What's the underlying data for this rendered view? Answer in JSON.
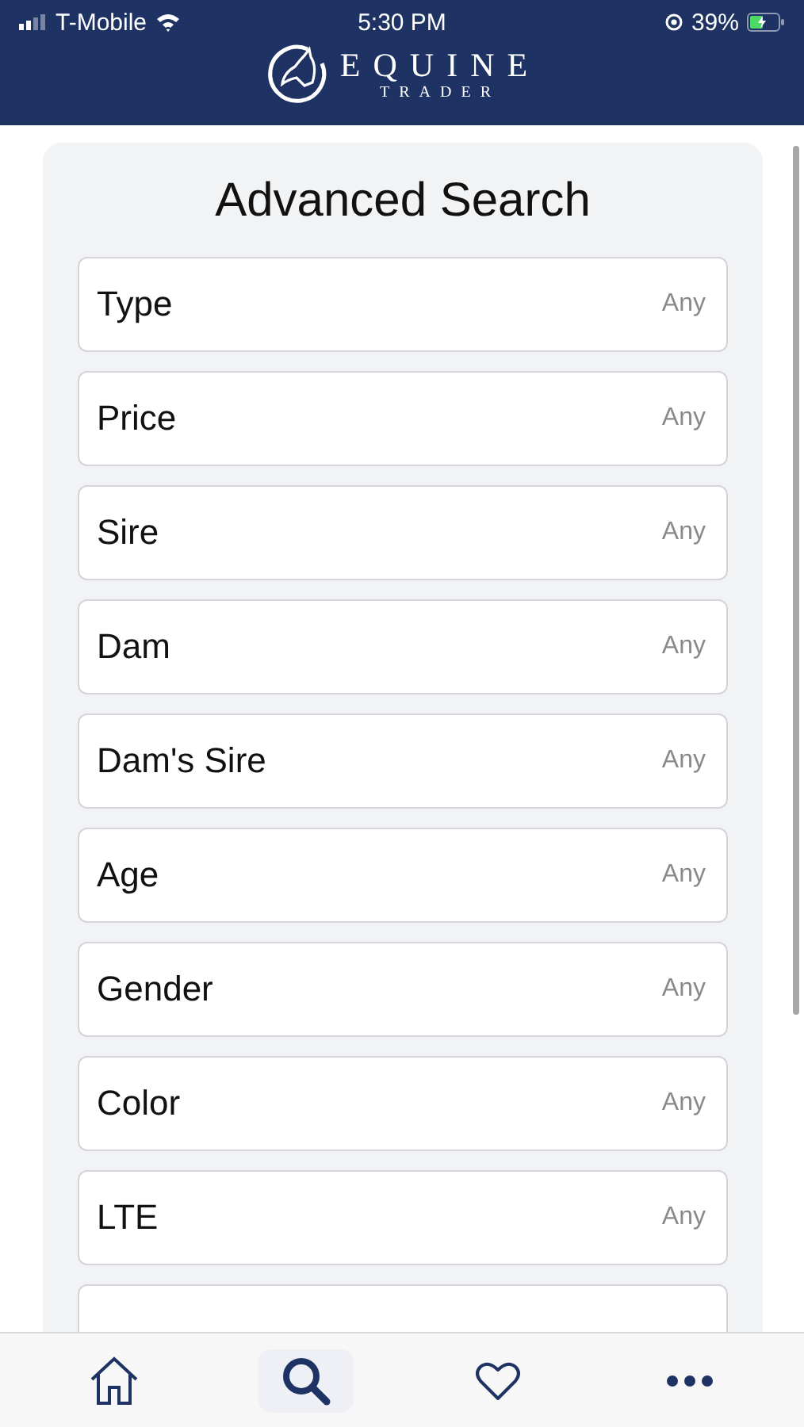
{
  "status_bar": {
    "carrier": "T-Mobile",
    "time": "5:30 PM",
    "battery": "39%"
  },
  "header": {
    "logo_title": "EQUINE",
    "logo_subtitle": "TRADER"
  },
  "title": "Advanced Search",
  "filters": [
    {
      "label": "Type",
      "value": "Any"
    },
    {
      "label": "Price",
      "value": "Any"
    },
    {
      "label": "Sire",
      "value": "Any"
    },
    {
      "label": "Dam",
      "value": "Any"
    },
    {
      "label": "Dam's Sire",
      "value": "Any"
    },
    {
      "label": "Age",
      "value": "Any"
    },
    {
      "label": "Gender",
      "value": "Any"
    },
    {
      "label": "Color",
      "value": "Any"
    },
    {
      "label": "LTE",
      "value": "Any"
    }
  ],
  "tab_bar": [
    {
      "kind": "home",
      "selected": false
    },
    {
      "kind": "search",
      "selected": true
    },
    {
      "kind": "favorites",
      "selected": false
    },
    {
      "kind": "more",
      "selected": false
    }
  ]
}
